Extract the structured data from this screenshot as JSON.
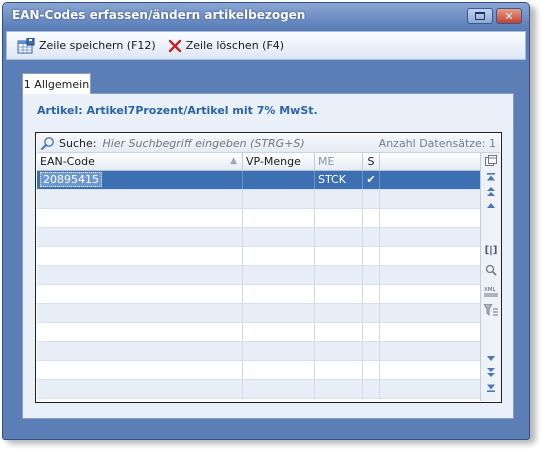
{
  "window": {
    "title": "EAN-Codes erfassen/ändern artikelbezogen"
  },
  "toolbar": {
    "save_label": "Zeile speichern (F12)",
    "delete_label": "Zeile löschen (F4)"
  },
  "tabs": [
    {
      "label": "1 Allgemein",
      "active": true
    }
  ],
  "artikel_label": "Artikel: Artikel7Prozent/Artikel mit 7% MwSt.",
  "search": {
    "label": "Suche:",
    "placeholder": "Hier Suchbegriff eingeben (STRG+S)",
    "count_text": "Anzahl Datensätze: 1"
  },
  "columns": [
    "EAN-Code",
    "VP-Menge",
    "ME",
    "S"
  ],
  "rows": [
    {
      "ean": "20895415",
      "vp_menge": "",
      "me": "STCK",
      "s": "✔"
    }
  ],
  "colors": {
    "accent": "#3d6fb3",
    "title_text": "#2b64a8"
  }
}
